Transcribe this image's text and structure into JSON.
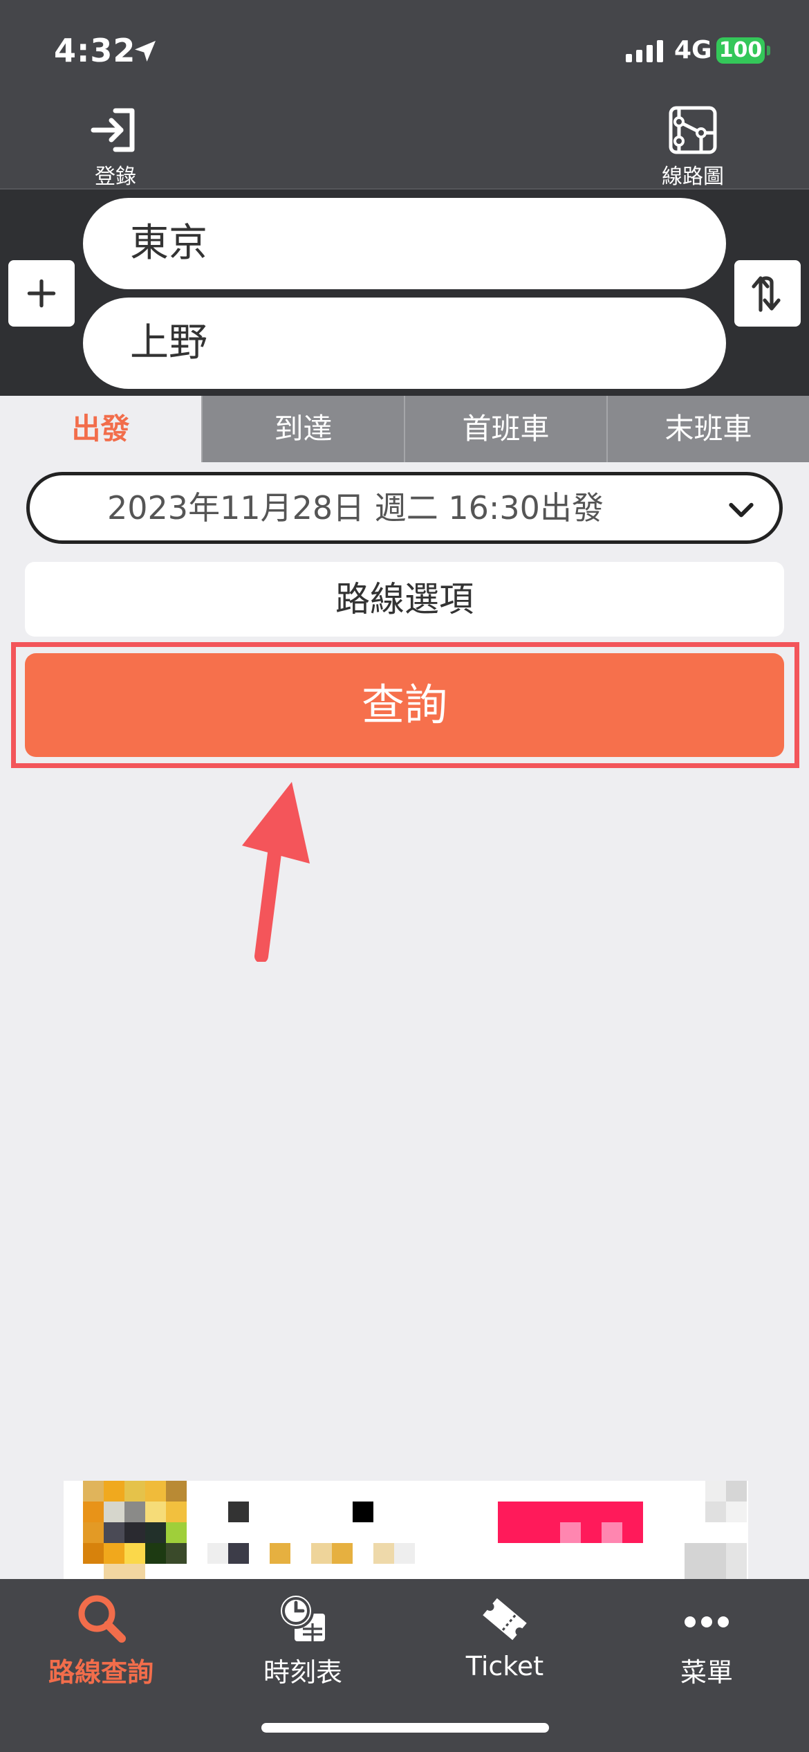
{
  "status_bar": {
    "time": "4:32",
    "network": "4G",
    "battery": "100"
  },
  "header": {
    "login_label": "登錄",
    "map_label": "線路圖"
  },
  "search": {
    "from_station": "東京",
    "to_station": "上野"
  },
  "tabs": [
    {
      "label": "出發",
      "active": true
    },
    {
      "label": "到達",
      "active": false
    },
    {
      "label": "首班車",
      "active": false
    },
    {
      "label": "末班車",
      "active": false
    }
  ],
  "datetime": {
    "value": "2023年11月28日 週二 16:30出發"
  },
  "route_options_label": "路線選項",
  "search_button_label": "查詢",
  "bottom_nav": [
    {
      "label": "路線查詢",
      "icon": "search-icon",
      "active": true
    },
    {
      "label": "時刻表",
      "icon": "timetable-icon",
      "active": false
    },
    {
      "label": "Ticket",
      "icon": "ticket-icon",
      "active": false
    },
    {
      "label": "菜單",
      "icon": "more-icon",
      "active": false
    }
  ],
  "colors": {
    "accent": "#f26d4b",
    "search_button": "#f6704c",
    "highlight": "#f3555a",
    "header_bg": "#45464a"
  }
}
